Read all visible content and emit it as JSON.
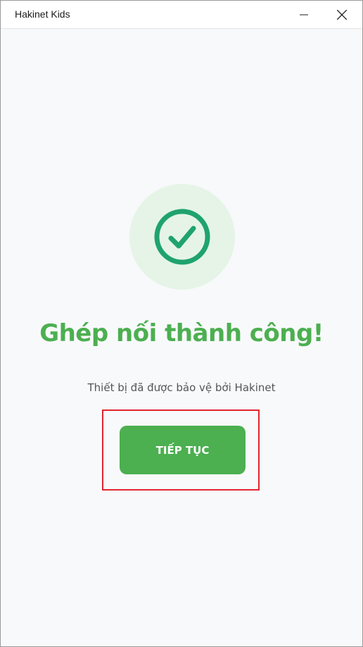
{
  "window": {
    "title": "Hakinet Kids"
  },
  "main": {
    "headline": "Ghép nối thành công!",
    "subtext": "Thiết bị đã được bảo vệ bởi Hakinet",
    "continue_label": "TIẾP TỤC"
  },
  "icons": {
    "status": "check-circle-icon",
    "minimize": "minimize-icon",
    "close": "close-icon"
  },
  "colors": {
    "accent": "#4caf50",
    "check_circle_bg": "#e5f4e7",
    "check_stroke": "#1fa36e",
    "highlight_border": "#e2262f"
  }
}
